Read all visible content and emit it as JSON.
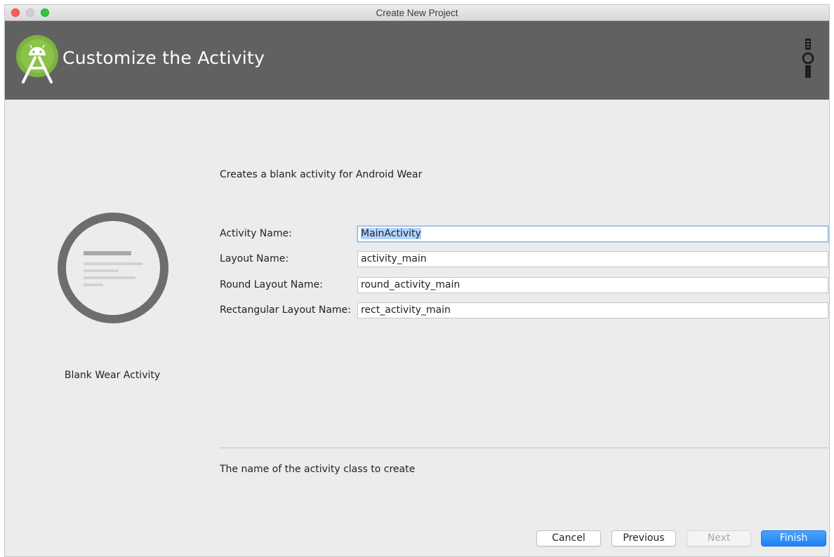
{
  "window": {
    "title": "Create New Project"
  },
  "header": {
    "title": "Customize the Activity",
    "logo_icon": "android-studio-logo-icon",
    "device_icon": "android-wear-watch-icon",
    "background_color": "#616161"
  },
  "template": {
    "name": "Blank Wear Activity",
    "preview_icon": "wear-round-preview-icon"
  },
  "form": {
    "description": "Creates a blank activity for Android Wear",
    "fields": [
      {
        "label": "Activity Name:",
        "value": "MainActivity"
      },
      {
        "label": "Layout Name:",
        "value": "activity_main"
      },
      {
        "label": "Round Layout Name:",
        "value": "round_activity_main"
      },
      {
        "label": "Rectangular Layout Name:",
        "value": "rect_activity_main"
      }
    ],
    "help_text": "The name of the activity class to create"
  },
  "buttons": {
    "cancel": "Cancel",
    "previous": "Previous",
    "next": "Next",
    "finish": "Finish"
  },
  "colors": {
    "accent": "#1a82f6",
    "selection": "#b3d3fd"
  }
}
